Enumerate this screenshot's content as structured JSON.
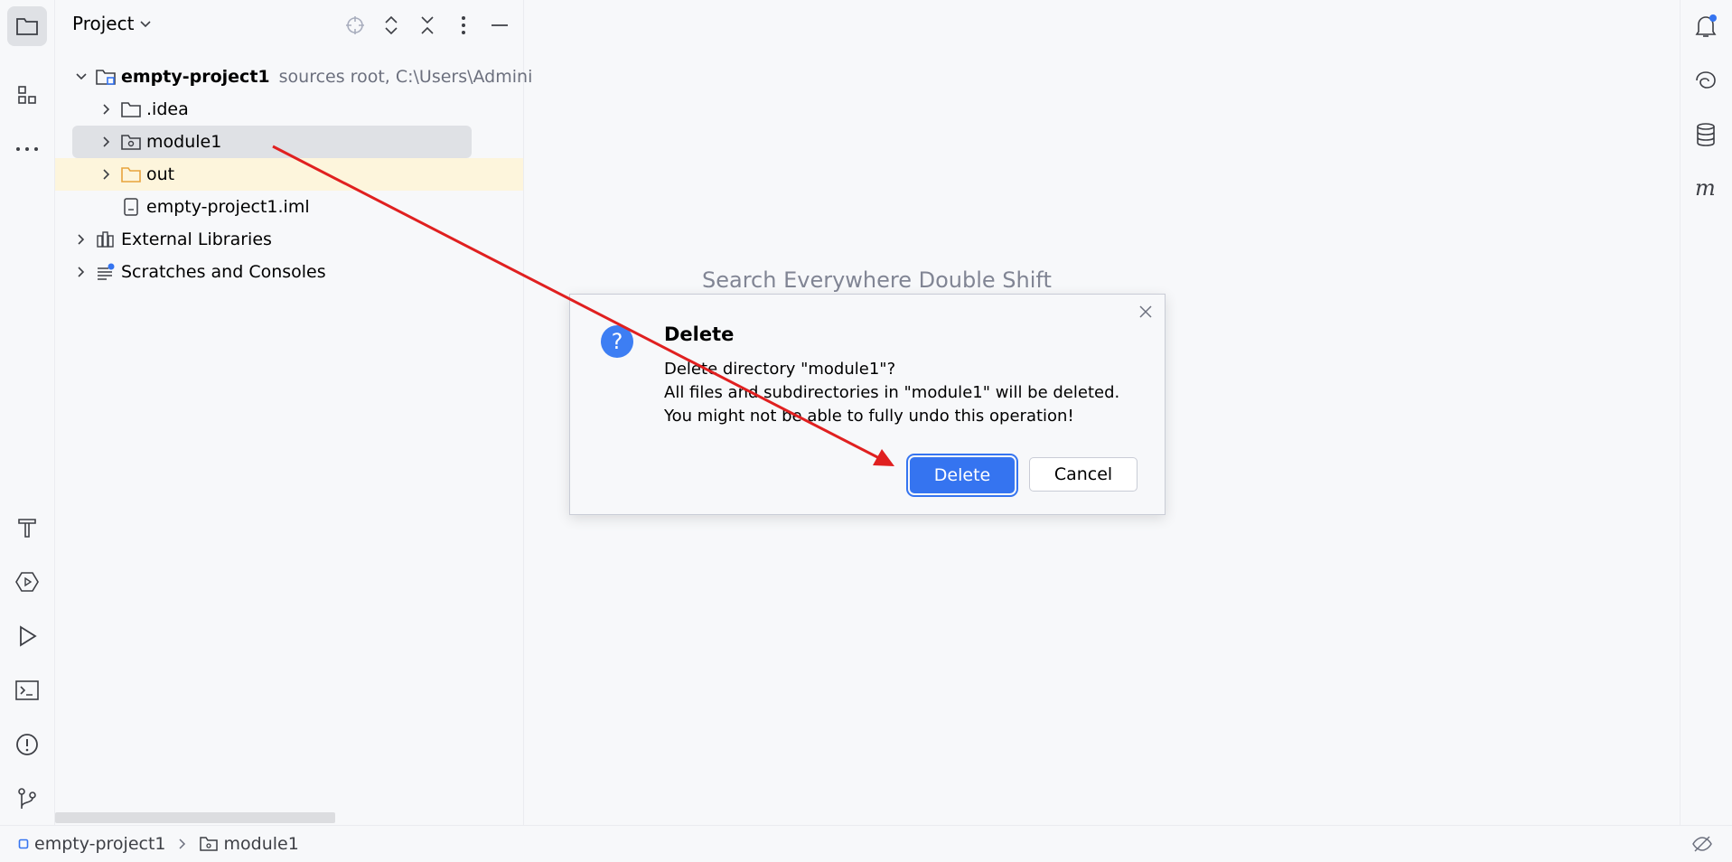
{
  "project_panel": {
    "title": "Project",
    "tree": [
      {
        "label": "empty-project1",
        "hint": "sources root,  C:\\Users\\Admini",
        "icon": "module-folder-icon"
      },
      {
        "label": ".idea",
        "icon": "folder-icon"
      },
      {
        "label": "module1",
        "icon": "module-folder-icon",
        "selected": true
      },
      {
        "label": "out",
        "icon": "excluded-folder-icon",
        "color": "#e8a33d"
      },
      {
        "label": "empty-project1.iml",
        "icon": "iml-file-icon"
      },
      {
        "label": "External Libraries",
        "icon": "library-icon"
      },
      {
        "label": "Scratches and Consoles",
        "icon": "scratches-icon"
      }
    ]
  },
  "editor": {
    "hint": "Search Everywhere Double Shift"
  },
  "dialog": {
    "title": "Delete",
    "message": [
      "Delete directory \"module1\"?",
      "All files and subdirectories in \"module1\" will be deleted.",
      "You might not be able to fully undo this operation!"
    ],
    "primary_button": "Delete",
    "secondary_button": "Cancel"
  },
  "statusbar": {
    "crumbs": [
      "empty-project1",
      "module1"
    ]
  },
  "colors": {
    "accent": "#3574f0",
    "annotation_arrow": "#e02020",
    "selection": "#dfe1e5"
  }
}
